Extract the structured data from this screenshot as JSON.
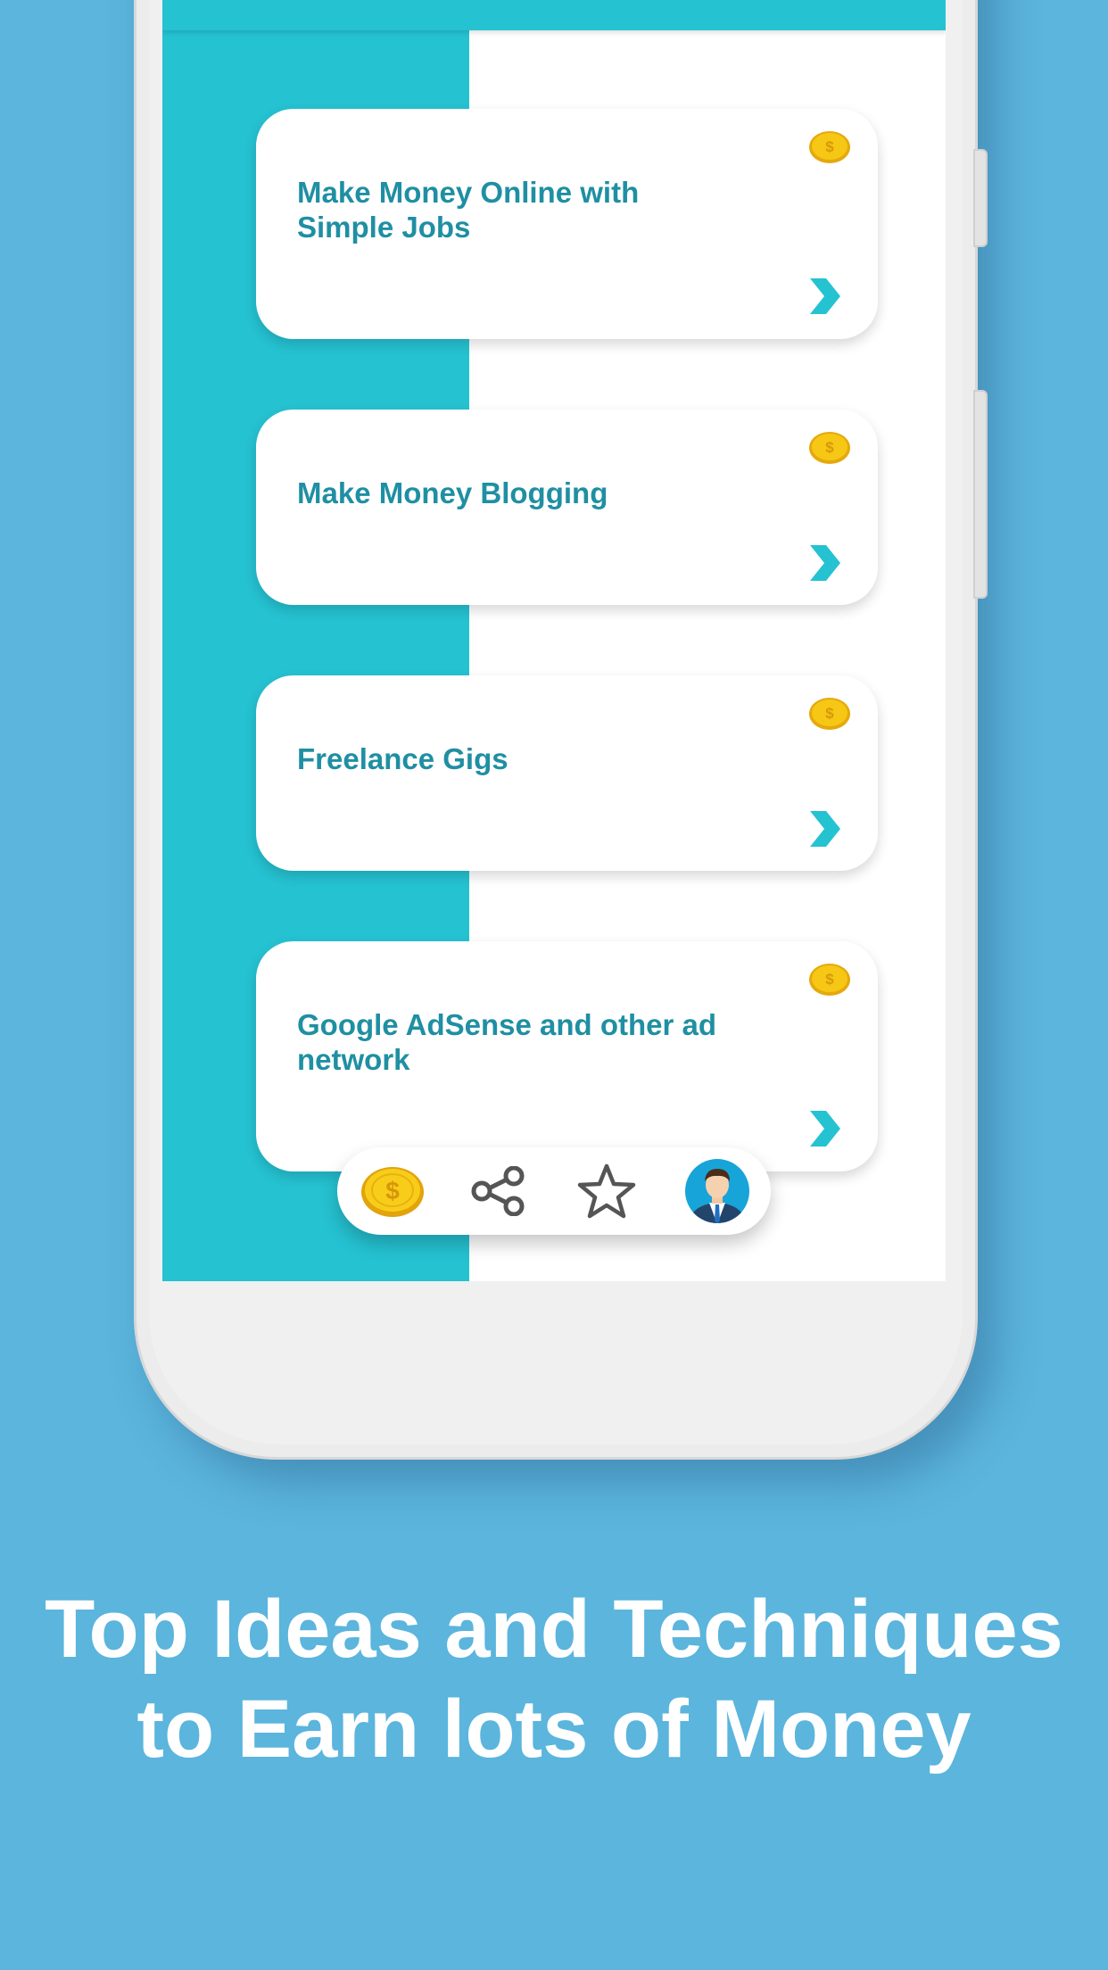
{
  "cards": [
    {
      "title_line1": "Make Money Online with",
      "title_line2": "Simple Jobs"
    },
    {
      "title_line1": "Make Money Blogging",
      "title_line2": ""
    },
    {
      "title_line1": "Freelance Gigs",
      "title_line2": ""
    },
    {
      "title_line1": "Google AdSense and other ad",
      "title_line2": "network"
    }
  ],
  "card_icons": {
    "badge": "coin-icon",
    "action": "chevron-right-icon"
  },
  "bottom_nav": [
    {
      "icon": "coin-icon"
    },
    {
      "icon": "share-icon"
    },
    {
      "icon": "star-icon"
    },
    {
      "icon": "avatar-icon"
    }
  ],
  "headline": {
    "line1": "Top Ideas and Techniques",
    "line2": "to Earn lots of Money"
  },
  "colors": {
    "background": "#5bb5dd",
    "accent": "#25c2d2",
    "card_title": "#1f8fa3",
    "coin": "#f6c715"
  }
}
